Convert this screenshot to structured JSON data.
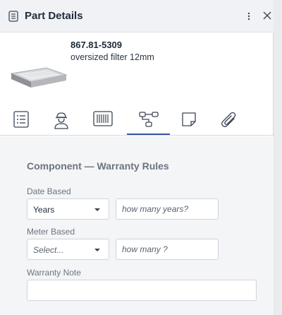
{
  "header": {
    "title": "Part Details",
    "icons": {
      "document": "document-icon",
      "more": "more-vertical-icon",
      "close": "close-icon"
    }
  },
  "part": {
    "number": "867.81-5309",
    "description": "oversized filter 12mm",
    "image": "filter-thumbnail"
  },
  "tabs": [
    {
      "icon": "list-icon",
      "active": false
    },
    {
      "icon": "worker-icon",
      "active": false
    },
    {
      "icon": "barcode-icon",
      "active": false
    },
    {
      "icon": "structure-icon",
      "active": true
    },
    {
      "icon": "note-icon",
      "active": false
    },
    {
      "icon": "paperclip-icon",
      "active": false
    }
  ],
  "warranty": {
    "section_title": "Component — Warranty Rules",
    "date_based": {
      "label": "Date Based",
      "select_value": "Years",
      "input_placeholder": "how many years?"
    },
    "meter_based": {
      "label": "Meter Based",
      "select_value": "Select...",
      "input_placeholder": "how many ?"
    },
    "note": {
      "label": "Warranty Note",
      "value": ""
    }
  },
  "colors": {
    "accent": "#3a57a8",
    "header_bg": "#f1f2f5",
    "body_bg": "#f4f5f7",
    "label_text": "#6b7480"
  }
}
